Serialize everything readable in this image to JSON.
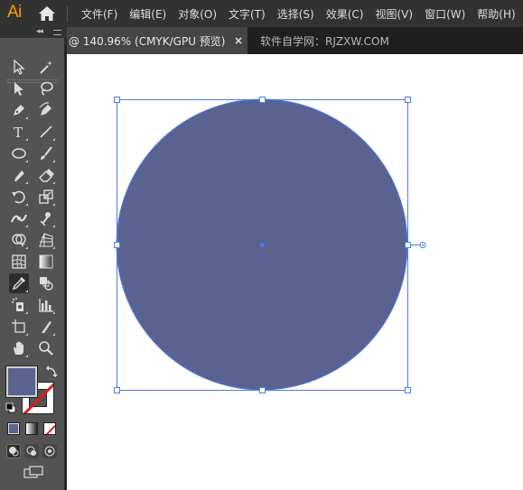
{
  "app": {
    "logo": "Ai"
  },
  "menu": [
    "文件(F)",
    "编辑(E)",
    "对象(O)",
    "文字(T)",
    "选择(S)",
    "效果(C)",
    "视图(V)",
    "窗口(W)",
    "帮助(H)"
  ],
  "tabs": {
    "active_label": "@ 140.96% (CMYK/GPU 预览)",
    "close_glyph": "×",
    "inactive_label": "软件自学网：RJZXW.COM"
  },
  "toolbar": {
    "collapse_glyph": "◂◂",
    "close_glyph": "×",
    "tools": [
      {
        "name": "selection-tool-icon"
      },
      {
        "name": "magic-wand-tool-icon"
      },
      {
        "name": "direct-selection-tool-icon"
      },
      {
        "name": "lasso-tool-icon"
      },
      {
        "name": "pen-tool-icon"
      },
      {
        "name": "curvature-tool-icon"
      },
      {
        "name": "type-tool-icon",
        "glyph": "T"
      },
      {
        "name": "line-segment-tool-icon"
      },
      {
        "name": "ellipse-tool-icon"
      },
      {
        "name": "paintbrush-tool-icon"
      },
      {
        "name": "shaper-tool-icon"
      },
      {
        "name": "eraser-tool-icon"
      },
      {
        "name": "rotate-tool-icon"
      },
      {
        "name": "scale-tool-icon"
      },
      {
        "name": "width-tool-icon"
      },
      {
        "name": "puppet-warp-tool-icon"
      },
      {
        "name": "shape-builder-tool-icon"
      },
      {
        "name": "perspective-grid-tool-icon"
      },
      {
        "name": "mesh-tool-icon"
      },
      {
        "name": "gradient-tool-icon"
      },
      {
        "name": "eyedropper-tool-icon",
        "active": true
      },
      {
        "name": "blend-tool-icon"
      },
      {
        "name": "symbol-sprayer-tool-icon"
      },
      {
        "name": "column-graph-tool-icon"
      },
      {
        "name": "artboard-tool-icon"
      },
      {
        "name": "slice-tool-icon"
      },
      {
        "name": "hand-tool-icon"
      },
      {
        "name": "zoom-tool-icon"
      }
    ]
  },
  "colors": {
    "fill": "#5b6490",
    "circle_fill": "#5a6390",
    "selection": "#4a7cf0",
    "accent_logo": "#ff9a00",
    "menubar_bg": "#323232",
    "toolbar_bg": "#535353"
  },
  "document": {
    "selected_shape": "ellipse",
    "stroke": "none"
  }
}
